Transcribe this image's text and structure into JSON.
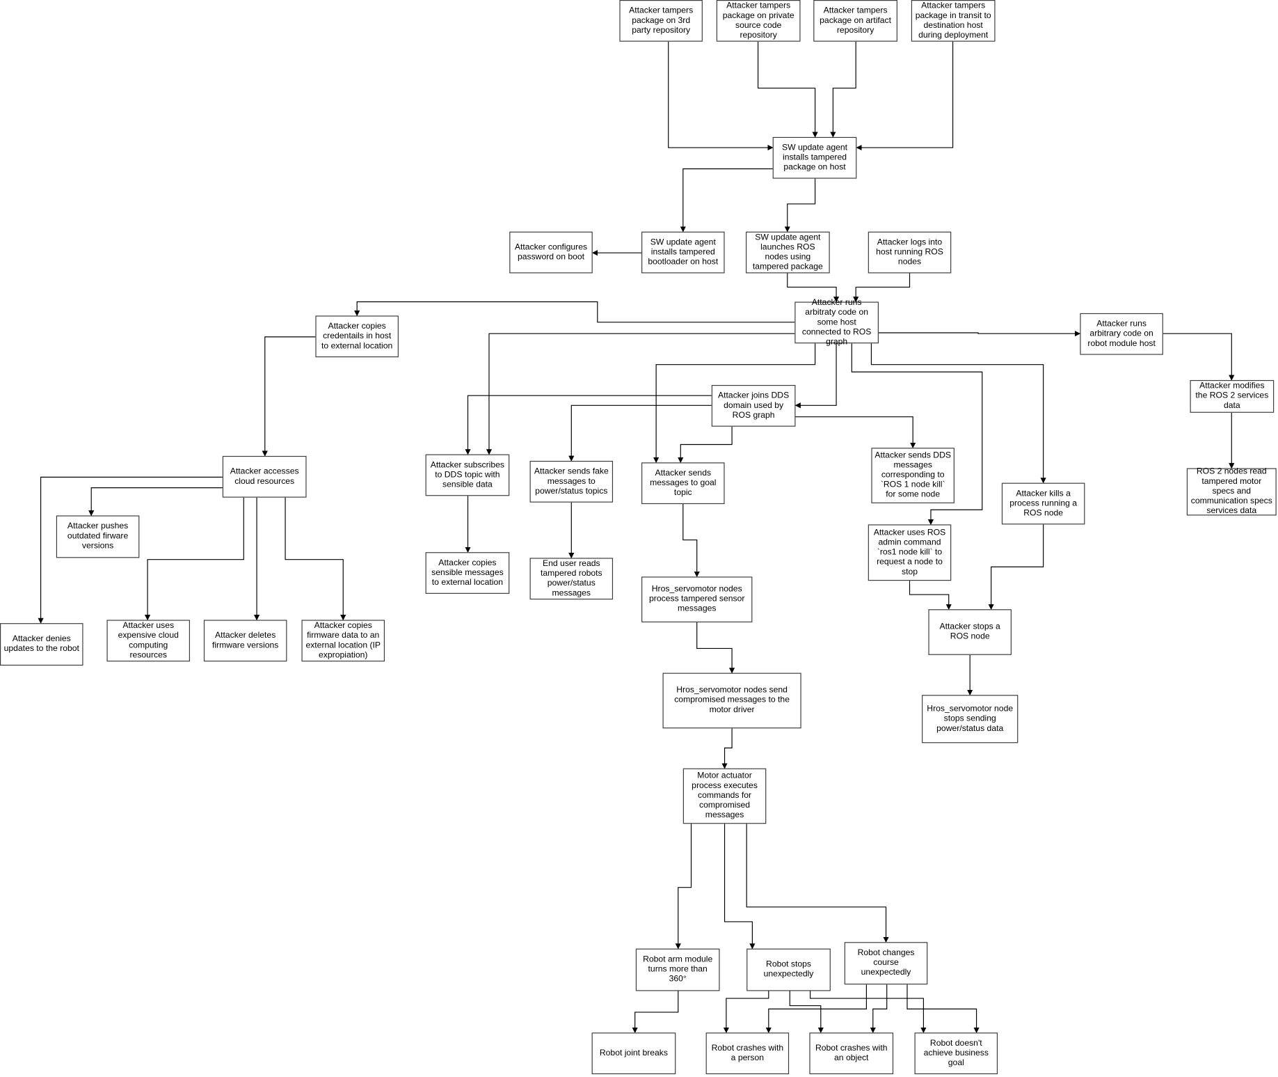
{
  "nodes": [
    {
      "label": "Attacker tampers package on 3rd party repository"
    },
    {
      "label": "Attacker tampers package on private source code repository"
    },
    {
      "label": "Attacker tampers package on artifact repository"
    },
    {
      "label": "Attacker tampers package in transit to destination host during deployment"
    },
    {
      "label": "SW update agent installs tampered package on host"
    },
    {
      "label": "SW update agent installs tampered bootloader on host"
    },
    {
      "label": "Attacker configures password on boot"
    },
    {
      "label": "SW update agent launches ROS nodes using tampered package"
    },
    {
      "label": "Attacker logs into host running ROS nodes"
    },
    {
      "label": "Attacker runs arbitraty code on some host connected to ROS graph"
    },
    {
      "label": "Attacker copies credentails in host to external location"
    },
    {
      "label": "Attacker runs arbitrary code on robot module host"
    },
    {
      "label": "Attacker modifies the ROS 2 services data"
    },
    {
      "label": "ROS 2 nodes read tampered motor specs and communication specs services data"
    },
    {
      "label": "Attacker joins DDS domain used by ROS graph"
    },
    {
      "label": "Attacker subscribes to DDS topic with sensible data"
    },
    {
      "label": "Attacker sends fake messages to power/status topics"
    },
    {
      "label": "Attacker sends messages to goal topic"
    },
    {
      "label": "Attacker sends DDS messages corresponding to `ROS 1 node kill` for some node"
    },
    {
      "label": "Attacker kills a process running a ROS node"
    },
    {
      "label": "Attacker uses ROS admin command `ros1 node kill` to request a node to stop"
    },
    {
      "label": "Attacker stops a ROS node"
    },
    {
      "label": "Hros_servomotor node stops sending power/status data"
    },
    {
      "label": "Attacker accesses cloud resources"
    },
    {
      "label": "Attacker pushes outdated firware versions"
    },
    {
      "label": "Attacker denies updates to the robot"
    },
    {
      "label": "Attacker uses expensive cloud computing resources"
    },
    {
      "label": "Attacker deletes firmware versions"
    },
    {
      "label": "Attacker copies firmware data to an external location (IP expropiation)"
    },
    {
      "label": "Attacker copies sensible messages to external location"
    },
    {
      "label": "End user reads tampered robots power/status messages"
    },
    {
      "label": "Hros_servomotor nodes process tampered sensor messages"
    },
    {
      "label": "Hros_servomotor nodes send compromised messages to the motor driver"
    },
    {
      "label": "Motor actuator process executes commands for compromised messages"
    },
    {
      "label": "Robot arm module turns more than 360°"
    },
    {
      "label": "Robot stops unexpectedly"
    },
    {
      "label": "Robot changes course unexpectedly"
    },
    {
      "label": "Robot joint breaks"
    },
    {
      "label": "Robot crashes with a person"
    },
    {
      "label": "Robot crashes with an object"
    },
    {
      "label": "Robot doesn't achieve business goal"
    }
  ]
}
